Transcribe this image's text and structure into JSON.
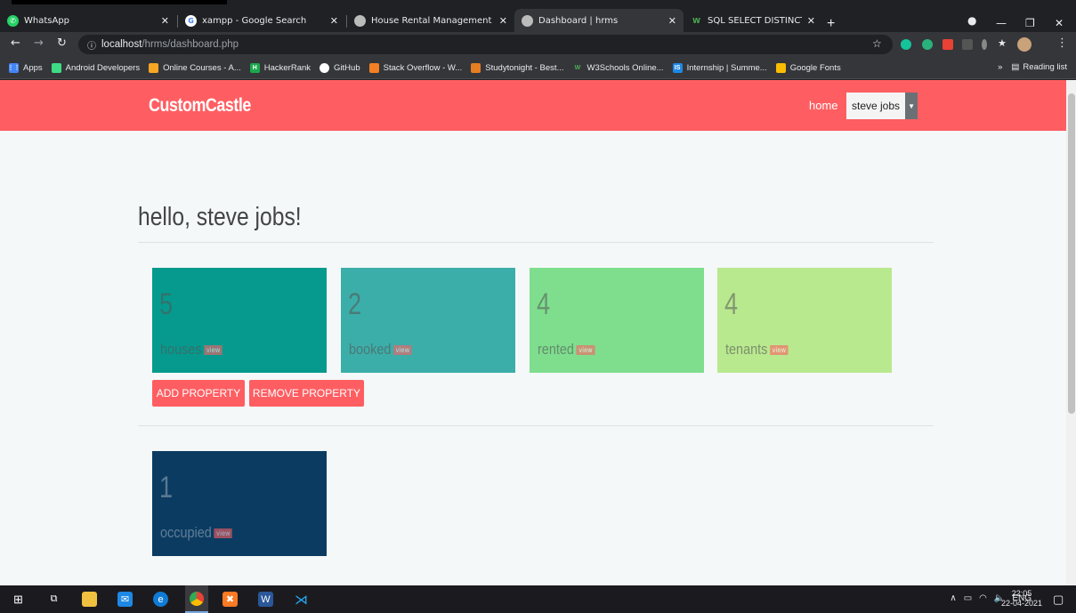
{
  "browser": {
    "tabs": [
      {
        "title": "WhatsApp",
        "icon": "whatsapp-icon"
      },
      {
        "title": "xampp - Google Search",
        "icon": "google-icon"
      },
      {
        "title": "House Rental Management Syste",
        "icon": "site-icon"
      },
      {
        "title": "Dashboard | hrms",
        "icon": "site-icon",
        "active": true
      },
      {
        "title": "SQL SELECT DISTINCT Statement",
        "icon": "w3schools-icon"
      }
    ],
    "url_host": "localhost",
    "url_path": "/hrms/dashboard.php",
    "bookmarks": [
      {
        "label": "Apps"
      },
      {
        "label": "Android Developers"
      },
      {
        "label": "Online Courses - A..."
      },
      {
        "label": "HackerRank"
      },
      {
        "label": "GitHub"
      },
      {
        "label": "Stack Overflow - W..."
      },
      {
        "label": "Studytonight - Best..."
      },
      {
        "label": "W3Schools Online..."
      },
      {
        "label": "Internship | Summe..."
      },
      {
        "label": "Google Fonts"
      }
    ],
    "reading_list": "Reading list"
  },
  "site": {
    "brand": "CustomCastle",
    "nav_home": "home",
    "user": "steve jobs",
    "accent": "#fe5e62"
  },
  "main": {
    "greeting": "hello, steve jobs!",
    "cards": [
      {
        "value": "5",
        "label": "houses",
        "view": "view",
        "color": "#069a8e"
      },
      {
        "value": "2",
        "label": "booked",
        "view": "view",
        "color": "#3caea9"
      },
      {
        "value": "4",
        "label": "rented",
        "view": "view",
        "color": "#7ede8e"
      },
      {
        "value": "4",
        "label": "tenants",
        "view": "view",
        "color": "#b9e98f"
      }
    ],
    "buttons": {
      "add": "ADD PROPERTY",
      "remove": "REMOVE PROPERTY"
    },
    "occupied": {
      "value": "1",
      "label": "occupied",
      "view": "view",
      "color": "#0b3b61"
    }
  },
  "taskbar": {
    "lang": "ENG",
    "time": "22:05",
    "date": "22-04-2021"
  }
}
